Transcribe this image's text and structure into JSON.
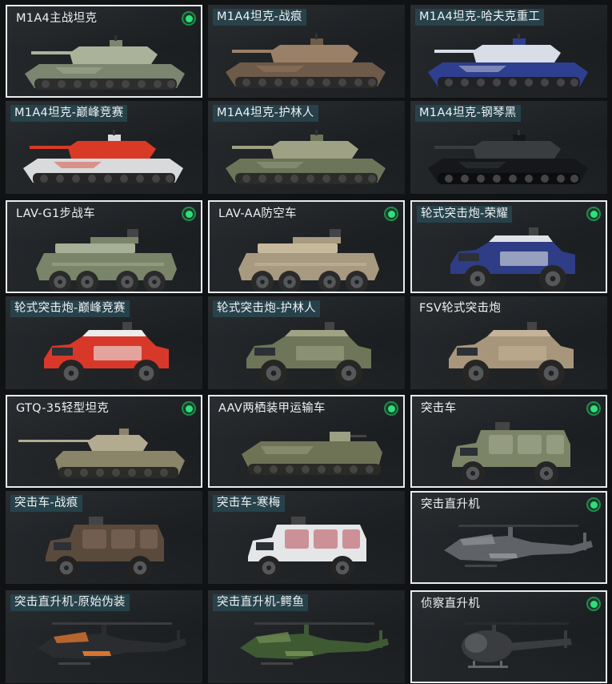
{
  "vehicles": [
    {
      "id": "m1a4",
      "label": "M1A4主战坦克",
      "selected": true,
      "equipped": true,
      "label_bg": false,
      "kind": "tank",
      "skin": {
        "body": "#7c8570",
        "accent": "#aab39a",
        "tread": "#2c2e2c"
      }
    },
    {
      "id": "m1a4-zhanhen",
      "label": "M1A4坦克-战痕",
      "selected": false,
      "equipped": false,
      "label_bg": true,
      "kind": "tank",
      "skin": {
        "body": "#6e5a48",
        "accent": "#9a8066",
        "tread": "#2a2a28"
      }
    },
    {
      "id": "m1a4-hafuke",
      "label": "M1A4坦克-哈夫克重工",
      "selected": false,
      "equipped": false,
      "label_bg": true,
      "kind": "tank",
      "skin": {
        "body": "#2f3f8f",
        "accent": "#d9dde6",
        "tread": "#202226"
      }
    },
    {
      "id": "m1a4-dianfeng",
      "label": "M1A4坦克-巅峰竞赛",
      "selected": false,
      "equipped": false,
      "label_bg": true,
      "kind": "tank",
      "skin": {
        "body": "#d8dadc",
        "accent": "#d93a26",
        "tread": "#262626"
      }
    },
    {
      "id": "m1a4-hulinren",
      "label": "M1A4坦克-护林人",
      "selected": false,
      "equipped": false,
      "label_bg": true,
      "kind": "tank",
      "skin": {
        "body": "#6d7558",
        "accent": "#9ea184",
        "tread": "#2b2c28"
      }
    },
    {
      "id": "m1a4-gangqinhei",
      "label": "M1A4坦克-钢琴黑",
      "selected": false,
      "equipped": false,
      "label_bg": true,
      "kind": "tank",
      "skin": {
        "body": "#15171a",
        "accent": "#3a3d40",
        "tread": "#0c0d0e"
      }
    },
    {
      "id": "lav-g1",
      "label": "LAV-G1步战车",
      "selected": true,
      "equipped": true,
      "label_bg": false,
      "kind": "apc8",
      "skin": {
        "body": "#7a8468",
        "accent": "#a7af96",
        "tread": "#2a2a2a"
      }
    },
    {
      "id": "lav-aa",
      "label": "LAV-AA防空车",
      "selected": true,
      "equipped": true,
      "label_bg": false,
      "kind": "apc8",
      "skin": {
        "body": "#a89a80",
        "accent": "#c7b99c",
        "tread": "#2a2a2a"
      }
    },
    {
      "id": "lunshi-rongyao",
      "label": "轮式突击炮-荣耀",
      "selected": true,
      "equipped": true,
      "label_bg": true,
      "kind": "wheeled4",
      "skin": {
        "body": "#2f3d86",
        "accent": "#dfe2e6",
        "tread": "#262626"
      }
    },
    {
      "id": "lunshi-dianfeng",
      "label": "轮式突击炮-巅峰竞赛",
      "selected": false,
      "equipped": false,
      "label_bg": true,
      "kind": "wheeled4",
      "skin": {
        "body": "#d8382a",
        "accent": "#ececec",
        "tread": "#242424"
      }
    },
    {
      "id": "lunshi-hulinren",
      "label": "轮式突击炮-护林人",
      "selected": false,
      "equipped": false,
      "label_bg": true,
      "kind": "wheeled4",
      "skin": {
        "body": "#6e7558",
        "accent": "#a0a284",
        "tread": "#262624"
      }
    },
    {
      "id": "fsv",
      "label": "FSV轮式突击炮",
      "selected": false,
      "equipped": false,
      "label_bg": false,
      "kind": "wheeled4",
      "skin": {
        "body": "#a8967c",
        "accent": "#c4b398",
        "tread": "#272625"
      }
    },
    {
      "id": "gtq-35",
      "label": "GTQ-35轻型坦克",
      "selected": true,
      "equipped": true,
      "label_bg": false,
      "kind": "lighttank",
      "skin": {
        "body": "#8a8468",
        "accent": "#b2ab90",
        "tread": "#2b2b28"
      }
    },
    {
      "id": "aav",
      "label": "AAV两栖装甲运输车",
      "selected": true,
      "equipped": true,
      "label_bg": false,
      "kind": "aav",
      "skin": {
        "body": "#6e7356",
        "accent": "#9ba083",
        "tread": "#2a2a26"
      }
    },
    {
      "id": "tujiche",
      "label": "突击车",
      "selected": true,
      "equipped": true,
      "label_bg": false,
      "kind": "truck",
      "skin": {
        "body": "#7c8468",
        "accent": "#a8af96",
        "tread": "#262626"
      }
    },
    {
      "id": "tujiche-zhanhen",
      "label": "突击车-战痕",
      "selected": false,
      "equipped": false,
      "label_bg": true,
      "kind": "truck",
      "skin": {
        "body": "#5a4a3c",
        "accent": "#857060",
        "tread": "#242322"
      }
    },
    {
      "id": "tujiche-hanmei",
      "label": "突击车-寒梅",
      "selected": false,
      "equipped": false,
      "label_bg": true,
      "kind": "truck",
      "skin": {
        "body": "#e4e6e8",
        "accent": "#b84a52",
        "tread": "#242424"
      }
    },
    {
      "id": "tuji-zhishengji",
      "label": "突击直升机",
      "selected": true,
      "equipped": true,
      "label_bg": false,
      "kind": "heli",
      "skin": {
        "body": "#5f6266",
        "accent": "#8b8f93",
        "tread": "#3a3c3e"
      }
    },
    {
      "id": "tuji-zsj-yuanshi",
      "label": "突击直升机-原始伪装",
      "selected": false,
      "equipped": false,
      "label_bg": true,
      "kind": "heli",
      "skin": {
        "body": "#2a2c30",
        "accent": "#d8742e",
        "tread": "#3a3c3e"
      }
    },
    {
      "id": "tuji-zsj-eyu",
      "label": "突击直升机-鳄鱼",
      "selected": false,
      "equipped": false,
      "label_bg": true,
      "kind": "heli",
      "skin": {
        "body": "#3e5a32",
        "accent": "#6e8a50",
        "tread": "#3a3c3e"
      }
    },
    {
      "id": "zhencha-zhishengji",
      "label": "侦察直升机",
      "selected": true,
      "equipped": true,
      "label_bg": false,
      "kind": "smallheli",
      "skin": {
        "body": "#3a3c3f",
        "accent": "#5c5f63",
        "tread": "#2a2b2d"
      }
    }
  ]
}
